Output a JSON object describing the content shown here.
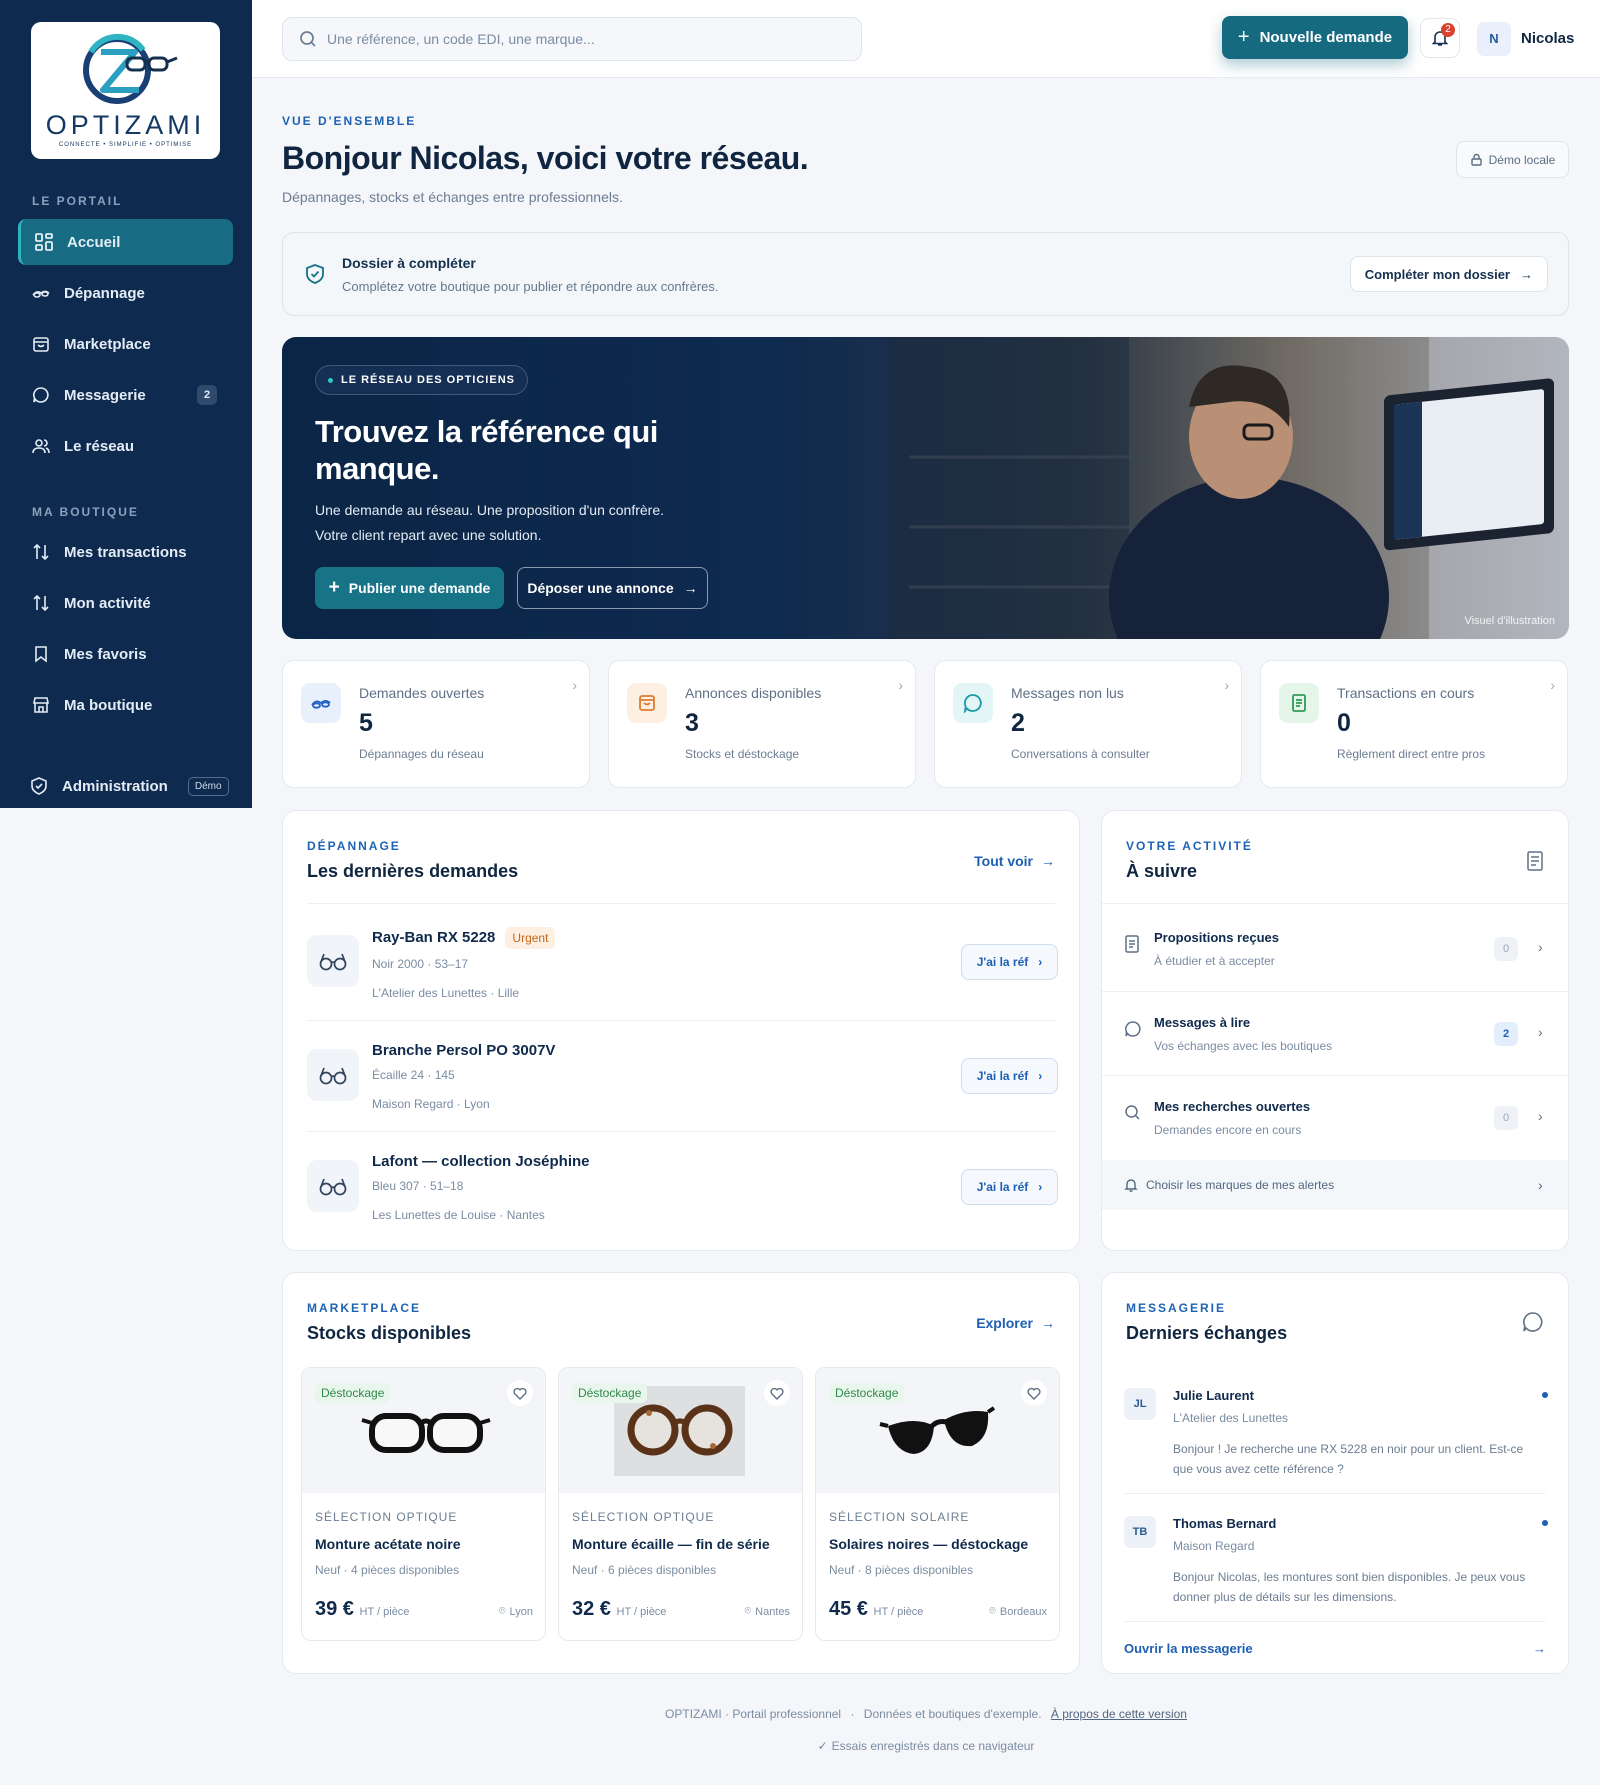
{
  "sidebar": {
    "logo": {
      "wordmark": "OPTIZAMI",
      "tagline": "CONNECTE • SIMPLIFIE • OPTIMISE"
    },
    "section_portal": "LE PORTAIL",
    "portal_items": [
      {
        "label": "Accueil",
        "icon": "grid-icon",
        "active": true
      },
      {
        "label": "Dépannage",
        "icon": "glasses-icon"
      },
      {
        "label": "Marketplace",
        "icon": "bag-icon"
      },
      {
        "label": "Messagerie",
        "icon": "chat-icon",
        "count": "2"
      },
      {
        "label": "Le réseau",
        "icon": "users-icon"
      }
    ],
    "section_shop": "MA BOUTIQUE",
    "shop_items": [
      {
        "label": "Mes transactions",
        "icon": "arrows-icon"
      },
      {
        "label": "Mon activité",
        "icon": "arrows-icon"
      },
      {
        "label": "Mes favoris",
        "icon": "bookmark-icon"
      },
      {
        "label": "Ma boutique",
        "icon": "store-icon"
      }
    ],
    "admin": {
      "label": "Administration",
      "tag": "Démo"
    }
  },
  "topbar": {
    "search_placeholder": "Une référence, un code EDI, une marque...",
    "new_request": "Nouvelle demande",
    "notif_count": "2",
    "avatar_initial": "N",
    "user_name": "Nicolas"
  },
  "header": {
    "kicker": "VUE D'ENSEMBLE",
    "title": "Bonjour Nicolas, voici votre réseau.",
    "subtitle": "Dépannages, stocks et échanges entre professionnels.",
    "demo_button": "Démo locale"
  },
  "dossier": {
    "title": "Dossier à compléter",
    "desc": "Complétez votre boutique pour publier et répondre aux confrères.",
    "button": "Compléter mon dossier"
  },
  "hero": {
    "pill": "LE RÉSEAU DES OPTICIENS",
    "title": "Trouvez la référence qui manque.",
    "text_line1": "Une demande au réseau. Une proposition d'un confrère.",
    "text_line2": "Votre client repart avec une solution.",
    "btn_publish": "Publier une demande",
    "btn_deposit": "Déposer une annonce",
    "caption": "Visuel d'illustration"
  },
  "stats": [
    {
      "label": "Demandes ouvertes",
      "value": "5",
      "desc": "Dépannages du réseau",
      "icon": "glasses-icon",
      "color": "#2563c9",
      "bg": "#e8f0fc"
    },
    {
      "label": "Annonces disponibles",
      "value": "3",
      "desc": "Stocks et déstockage",
      "icon": "bag-icon",
      "color": "#e07b2e",
      "bg": "#fdf0e3"
    },
    {
      "label": "Messages non lus",
      "value": "2",
      "desc": "Conversations à consulter",
      "icon": "chat-icon",
      "color": "#1a9aa8",
      "bg": "#e4f5f6"
    },
    {
      "label": "Transactions en cours",
      "value": "0",
      "desc": "Règlement direct entre pros",
      "icon": "document-icon",
      "color": "#2f9a58",
      "bg": "#e6f5ea"
    }
  ],
  "depannage": {
    "kicker": "DÉPANNAGE",
    "title": "Les dernières demandes",
    "link": "Tout voir",
    "ref_button": "J'ai la réf",
    "requests": [
      {
        "title": "Ray-Ban RX 5228",
        "urgent": "Urgent",
        "meta1": "Noir 2000 · 53–17",
        "meta2": "L'Atelier des Lunettes · Lille"
      },
      {
        "title": "Branche Persol PO 3007V",
        "urgent": "",
        "meta1": "Écaille 24 · 145",
        "meta2": "Maison Regard · Lyon"
      },
      {
        "title": "Lafont — collection Joséphine",
        "urgent": "",
        "meta1": "Bleu 307 · 51–18",
        "meta2": "Les Lunettes de Louise · Nantes"
      }
    ]
  },
  "activity": {
    "kicker": "VOTRE ACTIVITÉ",
    "title": "À suivre",
    "items": [
      {
        "title": "Propositions reçues",
        "desc": "À étudier et à accepter",
        "count": "0",
        "icon": "document-icon"
      },
      {
        "title": "Messages à lire",
        "desc": "Vos échanges avec les boutiques",
        "count": "2",
        "icon": "chat-icon"
      },
      {
        "title": "Mes recherches ouvertes",
        "desc": "Demandes encore en cours",
        "count": "0",
        "icon": "search-icon"
      }
    ],
    "alerts": "Choisir les marques de mes alertes"
  },
  "marketplace": {
    "kicker": "MARKETPLACE",
    "title": "Stocks disponibles",
    "link": "Explorer",
    "products": [
      {
        "tag": "Déstockage",
        "category": "SÉLECTION OPTIQUE",
        "name": "Monture acétate noire",
        "stock": "Neuf · 4 pièces disponibles",
        "price": "39 €",
        "unit": "HT / pièce",
        "city": "Lyon"
      },
      {
        "tag": "Déstockage",
        "category": "SÉLECTION OPTIQUE",
        "name": "Monture écaille — fin de série",
        "stock": "Neuf · 6 pièces disponibles",
        "price": "32 €",
        "unit": "HT / pièce",
        "city": "Nantes"
      },
      {
        "tag": "Déstockage",
        "category": "SÉLECTION SOLAIRE",
        "name": "Solaires noires — déstockage",
        "stock": "Neuf · 8 pièces disponibles",
        "price": "45 €",
        "unit": "HT / pièce",
        "city": "Bordeaux"
      }
    ]
  },
  "messaging": {
    "kicker": "MESSAGERIE",
    "title": "Derniers échanges",
    "messages": [
      {
        "initials": "JL",
        "name": "Julie Laurent",
        "shop": "L'Atelier des Lunettes",
        "text": "Bonjour ! Je recherche une RX 5228 en noir pour un client. Est-ce que vous avez cette référence ?"
      },
      {
        "initials": "TB",
        "name": "Thomas Bernard",
        "shop": "Maison Regard",
        "text": "Bonjour Nicolas, les montures sont bien disponibles. Je peux vous donner plus de détails sur les dimensions."
      }
    ],
    "open_link": "Ouvrir la messagerie"
  },
  "footer": {
    "brand": "OPTIZAMI · Portail professionnel",
    "sep": "·",
    "data_note": "Données et boutiques d'exemple.",
    "about": "À propos de cette version",
    "saved": "Essais enregistrés dans ce navigateur"
  },
  "colors": {
    "sidebar": "#0e2a4e",
    "accent": "#166a80",
    "link": "#1e5fb3"
  }
}
